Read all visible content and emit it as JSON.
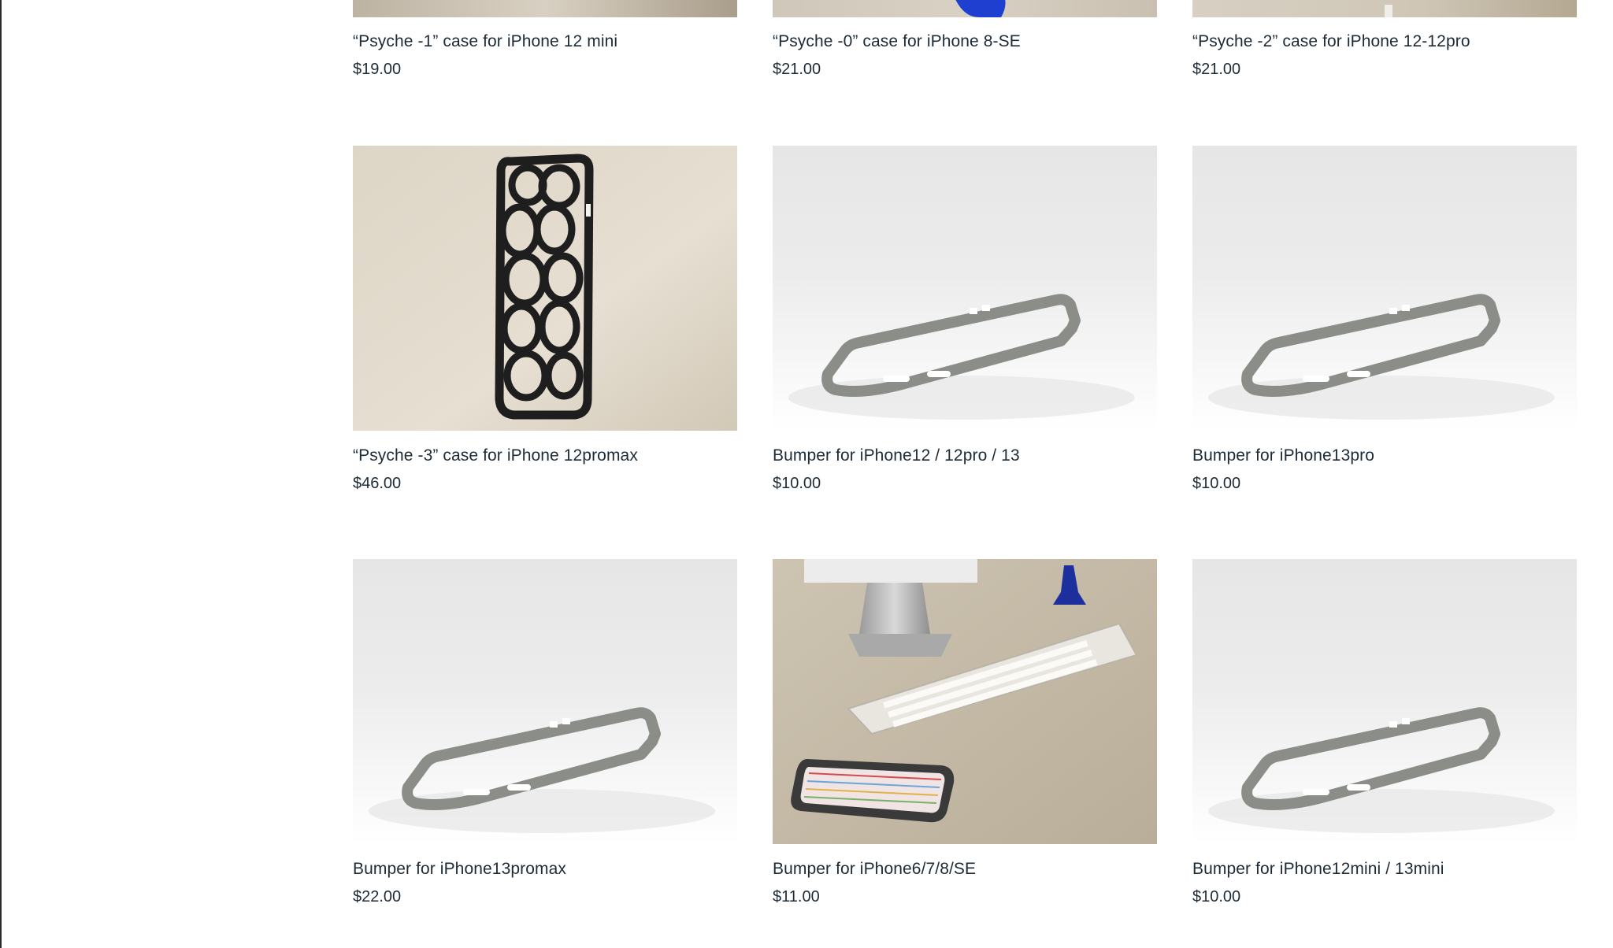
{
  "products": [
    {
      "title": "“Psyche -1” case for iPhone 12 mini",
      "price": "$19.00",
      "image": "psyche-case-photo"
    },
    {
      "title": "“Psyche -0” case for iPhone 8-SE",
      "price": "$21.00",
      "image": "psyche-case-photo"
    },
    {
      "title": "“Psyche -2” case for iPhone 12-12pro",
      "price": "$21.00",
      "image": "psyche-case-photo"
    },
    {
      "title": "“Psyche -3” case for iPhone 12promax",
      "price": "$46.00",
      "image": "psyche-case-black"
    },
    {
      "title": "Bumper for iPhone12 / 12pro / 13",
      "price": "$10.00",
      "image": "bumper-render"
    },
    {
      "title": "Bumper for iPhone13pro",
      "price": "$10.00",
      "image": "bumper-render"
    },
    {
      "title": "Bumper for iPhone13promax",
      "price": "$22.00",
      "image": "bumper-render"
    },
    {
      "title": "Bumper for iPhone6/7/8/SE",
      "price": "$11.00",
      "image": "desk-scene-photo"
    },
    {
      "title": "Bumper for iPhone12mini / 13mini",
      "price": "$10.00",
      "image": "bumper-render"
    }
  ],
  "colors": {
    "text": "#1d2b36",
    "bumper": "#8b8d88",
    "photo_bg": "#d9d2c2"
  }
}
